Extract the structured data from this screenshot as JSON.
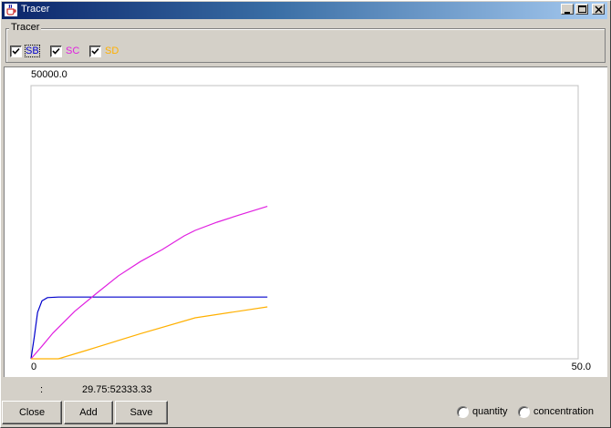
{
  "window": {
    "title": "Tracer"
  },
  "tracer_group": {
    "legend": "Tracer",
    "checkboxes": [
      {
        "label": "SB",
        "checked": true,
        "color": "#0000cc"
      },
      {
        "label": "SC",
        "checked": true,
        "color": "#e020e0"
      },
      {
        "label": "SD",
        "checked": true,
        "color": "#ffb000"
      }
    ]
  },
  "chart_data": {
    "type": "line",
    "xlim": [
      0,
      50.0
    ],
    "ylim": [
      0,
      50000.0
    ],
    "x_min_label": "0",
    "x_max_label": "50.0",
    "y_max_label": "50000.0",
    "grid": false,
    "series": [
      {
        "color": "#0000cc",
        "points": [
          [
            0,
            0
          ],
          [
            0.3,
            4000
          ],
          [
            0.6,
            8500
          ],
          [
            1.0,
            10600
          ],
          [
            1.5,
            11200
          ],
          [
            2.5,
            11300
          ],
          [
            5,
            11300
          ],
          [
            10,
            11300
          ],
          [
            15,
            11300
          ],
          [
            21.6,
            11300
          ]
        ]
      },
      {
        "color": "#e020e0",
        "points": [
          [
            0,
            0
          ],
          [
            1,
            2300
          ],
          [
            2,
            4700
          ],
          [
            4,
            8700
          ],
          [
            6,
            12000
          ],
          [
            8,
            15200
          ],
          [
            10,
            17800
          ],
          [
            12,
            20000
          ],
          [
            14,
            22500
          ],
          [
            15,
            23500
          ],
          [
            17,
            25000
          ],
          [
            19,
            26300
          ],
          [
            21.6,
            27900
          ]
        ]
      },
      {
        "color": "#ffb000",
        "points": [
          [
            0,
            0
          ],
          [
            2.5,
            0
          ],
          [
            5,
            1500
          ],
          [
            10,
            4600
          ],
          [
            15,
            7500
          ],
          [
            21.6,
            9500
          ]
        ]
      }
    ]
  },
  "status": {
    "colon": ":",
    "value": "29.75:52333.33"
  },
  "buttons": {
    "close": "Close",
    "add": "Add",
    "save": "Save"
  },
  "radios": [
    {
      "label": "quantity",
      "selected": false
    },
    {
      "label": "concentration",
      "selected": false
    }
  ]
}
